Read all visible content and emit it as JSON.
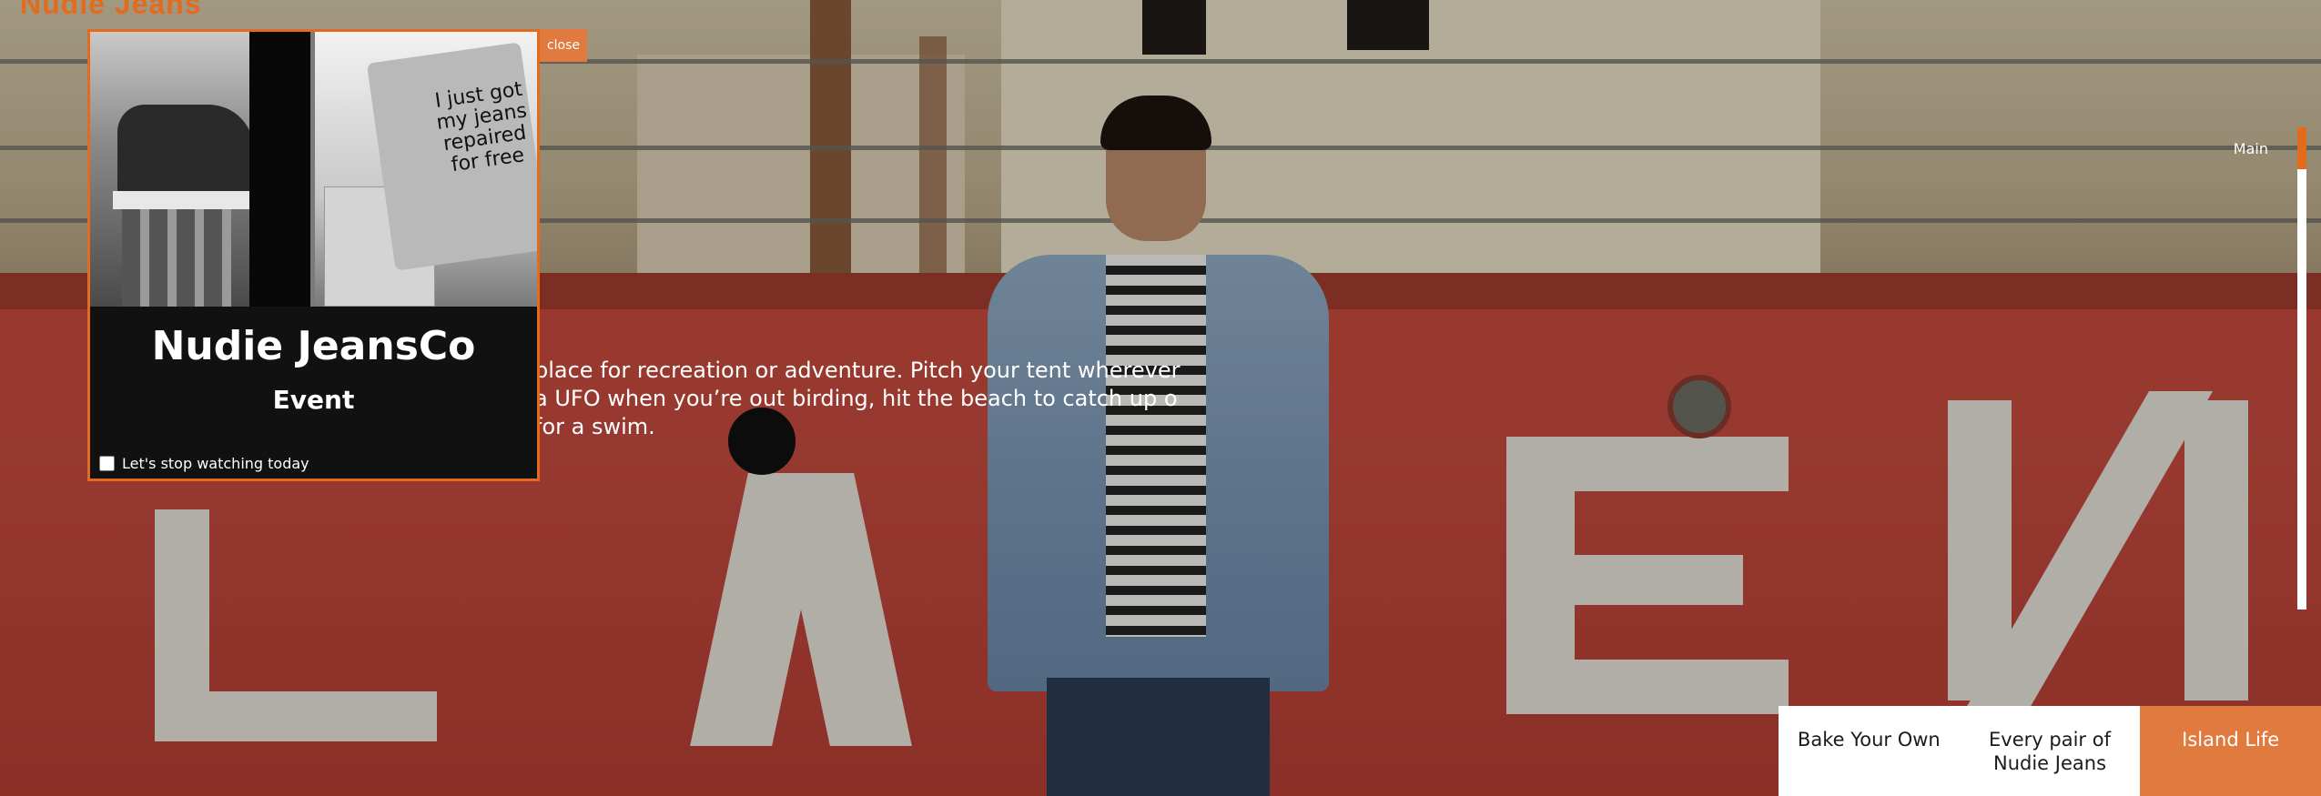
{
  "brand": {
    "logo_text": "Nudie Jeans",
    "accent_color": "#e46b1d"
  },
  "hero": {
    "body_text": "place for recreation or adventure. Pitch your tent wherever a UFO when you’re out birding, hit the beach to catch up o for a swim."
  },
  "side_nav": {
    "section_label": "Main"
  },
  "tabs": [
    {
      "label": "Bake Your Own",
      "active": false
    },
    {
      "label": "Every pair of Nudie Jeans",
      "active": false
    },
    {
      "label": "Island Life",
      "active": true
    }
  ],
  "popup": {
    "close_label": "close",
    "image_text": "I just got my jeans repaired for free",
    "title": "Nudie JeansCo",
    "subtitle": "Event",
    "checkbox_label": "Let's stop watching today",
    "checkbox_checked": false
  }
}
